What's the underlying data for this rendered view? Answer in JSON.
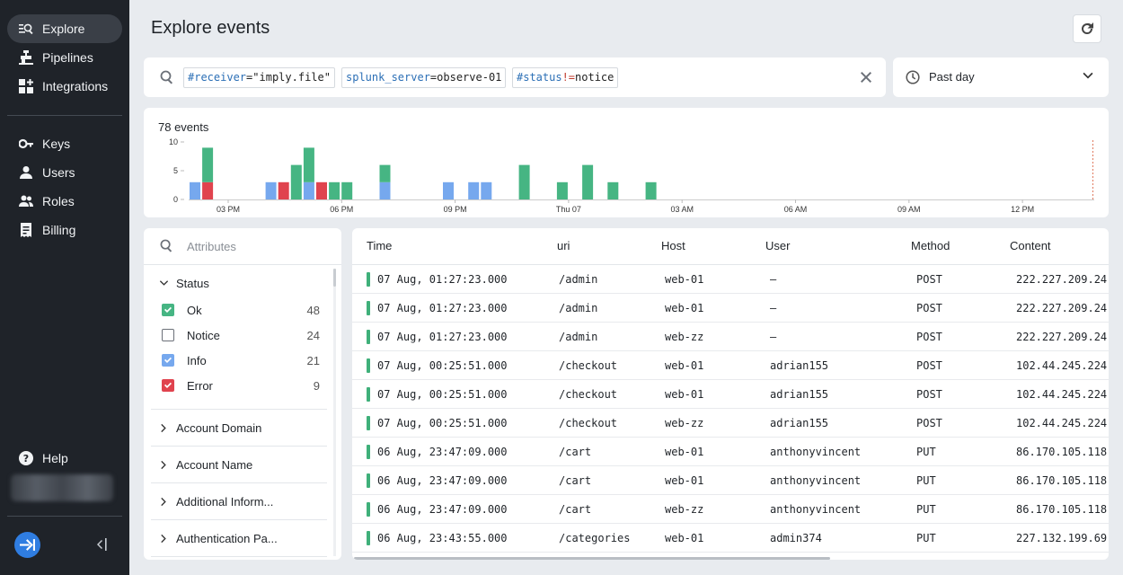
{
  "sidebar": {
    "items": [
      {
        "label": "Explore",
        "icon": "explore-icon",
        "active": true
      },
      {
        "label": "Pipelines",
        "icon": "pipelines-icon"
      },
      {
        "label": "Integrations",
        "icon": "integrations-icon"
      },
      {
        "label": "Keys",
        "icon": "key-icon"
      },
      {
        "label": "Users",
        "icon": "user-icon"
      },
      {
        "label": "Roles",
        "icon": "roles-icon"
      },
      {
        "label": "Billing",
        "icon": "billing-icon"
      }
    ],
    "help_label": "Help"
  },
  "header": {
    "title": "Explore events"
  },
  "search": {
    "chips": [
      {
        "key": "#receiver",
        "op": "=",
        "value": "\"imply.file\""
      },
      {
        "key": "splunk_server",
        "op": "=",
        "value": "observe-01"
      },
      {
        "key": "#status",
        "op": "!=",
        "value": "notice"
      }
    ]
  },
  "time_range": {
    "label": "Past day"
  },
  "histogram": {
    "count_label": "78 events"
  },
  "chart_data": {
    "type": "bar",
    "stacked": true,
    "y_ticks": [
      0,
      5,
      10
    ],
    "ylim": [
      0,
      10
    ],
    "x_tick_labels": [
      "03 PM",
      "06 PM",
      "09 PM",
      "Thu 07",
      "03 AM",
      "06 AM",
      "09 AM",
      "12 PM"
    ],
    "series": [
      {
        "name": "Info",
        "color": "#76a8ee"
      },
      {
        "name": "Error",
        "color": "#e0434e"
      },
      {
        "name": "Ok",
        "color": "#46b583"
      }
    ],
    "bins": [
      {
        "info": 3,
        "error": 0,
        "ok": 0
      },
      {
        "info": 0,
        "error": 3,
        "ok": 6
      },
      {
        "info": 0,
        "error": 0,
        "ok": 0
      },
      {
        "info": 0,
        "error": 0,
        "ok": 0
      },
      {
        "info": 0,
        "error": 0,
        "ok": 0
      },
      {
        "info": 0,
        "error": 0,
        "ok": 0
      },
      {
        "info": 3,
        "error": 0,
        "ok": 0
      },
      {
        "info": 0,
        "error": 3,
        "ok": 0
      },
      {
        "info": 0,
        "error": 0,
        "ok": 6
      },
      {
        "info": 3,
        "error": 0,
        "ok": 6
      },
      {
        "info": 0,
        "error": 3,
        "ok": 0
      },
      {
        "info": 0,
        "error": 0,
        "ok": 3
      },
      {
        "info": 0,
        "error": 0,
        "ok": 3
      },
      {
        "info": 0,
        "error": 0,
        "ok": 0
      },
      {
        "info": 0,
        "error": 0,
        "ok": 0
      },
      {
        "info": 3,
        "error": 0,
        "ok": 3
      },
      {
        "info": 0,
        "error": 0,
        "ok": 0
      },
      {
        "info": 0,
        "error": 0,
        "ok": 0
      },
      {
        "info": 0,
        "error": 0,
        "ok": 0
      },
      {
        "info": 0,
        "error": 0,
        "ok": 0
      },
      {
        "info": 3,
        "error": 0,
        "ok": 0
      },
      {
        "info": 0,
        "error": 0,
        "ok": 0
      },
      {
        "info": 3,
        "error": 0,
        "ok": 0
      },
      {
        "info": 3,
        "error": 0,
        "ok": 0
      },
      {
        "info": 0,
        "error": 0,
        "ok": 0
      },
      {
        "info": 0,
        "error": 0,
        "ok": 0
      },
      {
        "info": 0,
        "error": 0,
        "ok": 6
      },
      {
        "info": 0,
        "error": 0,
        "ok": 0
      },
      {
        "info": 0,
        "error": 0,
        "ok": 0
      },
      {
        "info": 0,
        "error": 0,
        "ok": 3
      },
      {
        "info": 0,
        "error": 0,
        "ok": 0
      },
      {
        "info": 0,
        "error": 0,
        "ok": 6
      },
      {
        "info": 0,
        "error": 0,
        "ok": 0
      },
      {
        "info": 0,
        "error": 0,
        "ok": 3
      },
      {
        "info": 0,
        "error": 0,
        "ok": 0
      },
      {
        "info": 0,
        "error": 0,
        "ok": 0
      },
      {
        "info": 0,
        "error": 0,
        "ok": 3
      }
    ]
  },
  "attributes": {
    "search_placeholder": "Attributes",
    "status_group": "Status",
    "statuses": [
      {
        "label": "Ok",
        "count": "48",
        "checked": true,
        "color": "#46b583"
      },
      {
        "label": "Notice",
        "count": "24",
        "checked": false,
        "color": ""
      },
      {
        "label": "Info",
        "count": "21",
        "checked": true,
        "color": "#76a8ee"
      },
      {
        "label": "Error",
        "count": "9",
        "checked": true,
        "color": "#e0434e"
      }
    ],
    "groups": [
      "Account Domain",
      "Account Name",
      "Additional Inform...",
      "Authentication Pa..."
    ]
  },
  "events": {
    "columns": [
      "Time",
      "uri",
      "Host",
      "User",
      "Method",
      "Content"
    ],
    "rows": [
      [
        "07 Aug, 01:27:23.000",
        "/admin",
        "web-01",
        "–",
        "POST",
        "222.227.209.24"
      ],
      [
        "07 Aug, 01:27:23.000",
        "/admin",
        "web-01",
        "–",
        "POST",
        "222.227.209.24"
      ],
      [
        "07 Aug, 01:27:23.000",
        "/admin",
        "web-zz",
        "–",
        "POST",
        "222.227.209.24"
      ],
      [
        "07 Aug, 00:25:51.000",
        "/checkout",
        "web-01",
        "adrian155",
        "POST",
        "102.44.245.224"
      ],
      [
        "07 Aug, 00:25:51.000",
        "/checkout",
        "web-01",
        "adrian155",
        "POST",
        "102.44.245.224"
      ],
      [
        "07 Aug, 00:25:51.000",
        "/checkout",
        "web-zz",
        "adrian155",
        "POST",
        "102.44.245.224"
      ],
      [
        "06 Aug, 23:47:09.000",
        "/cart",
        "web-01",
        "anthonyvincent",
        "PUT",
        "86.170.105.118"
      ],
      [
        "06 Aug, 23:47:09.000",
        "/cart",
        "web-01",
        "anthonyvincent",
        "PUT",
        "86.170.105.118"
      ],
      [
        "06 Aug, 23:47:09.000",
        "/cart",
        "web-zz",
        "anthonyvincent",
        "PUT",
        "86.170.105.118"
      ],
      [
        "06 Aug, 23:43:55.000",
        "/categories",
        "web-01",
        "admin374",
        "PUT",
        "227.132.199.69"
      ]
    ]
  }
}
